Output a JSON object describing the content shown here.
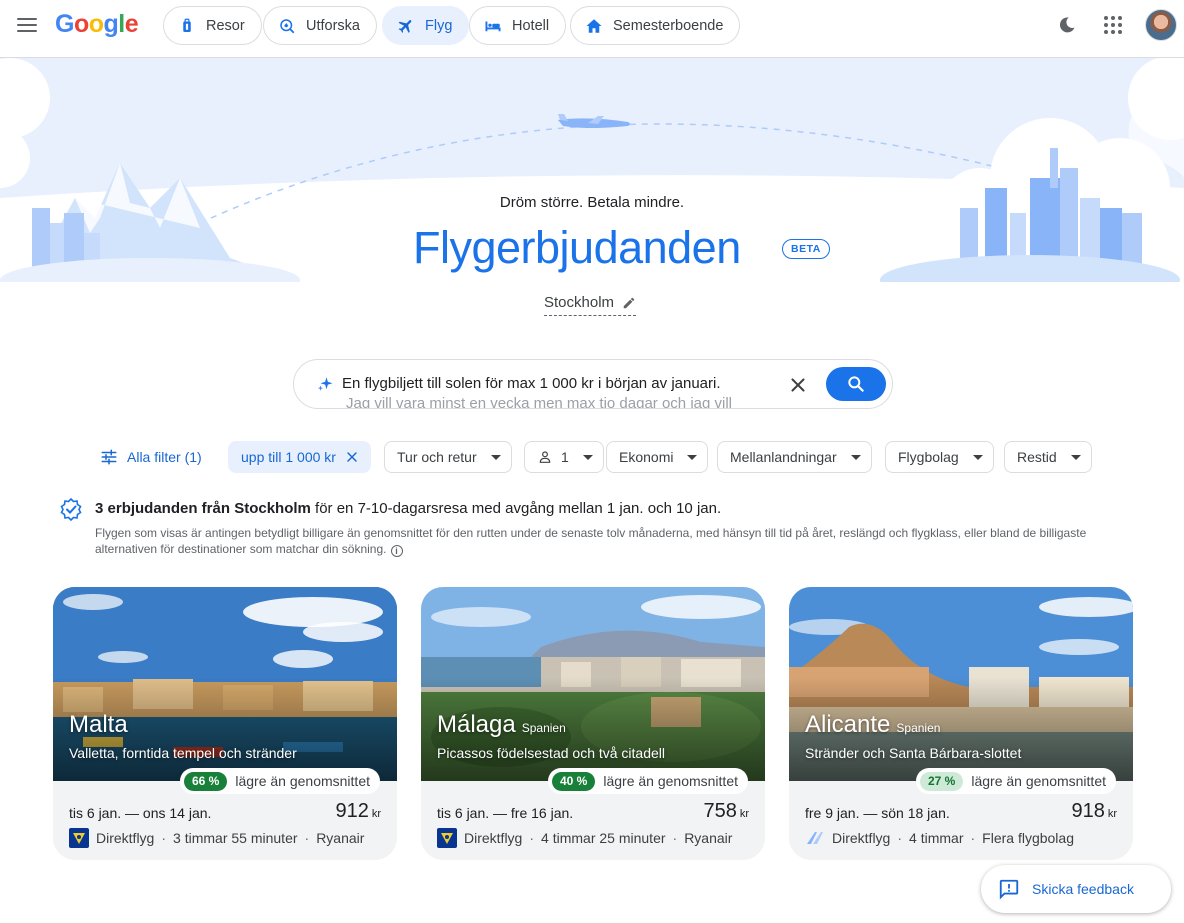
{
  "header": {
    "logo_letters": [
      "G",
      "o",
      "o",
      "g",
      "l",
      "e"
    ],
    "logo_colors": [
      "#4285F4",
      "#EA4335",
      "#FBBC05",
      "#4285F4",
      "#34A853",
      "#EA4335"
    ],
    "nav": [
      {
        "label": "Resor",
        "icon": "suitcase-icon",
        "active": false
      },
      {
        "label": "Utforska",
        "icon": "explore-icon",
        "active": false
      },
      {
        "label": "Flyg",
        "icon": "airplane-icon",
        "active": true
      },
      {
        "label": "Hotell",
        "icon": "bed-icon",
        "active": false
      },
      {
        "label": "Semesterboende",
        "icon": "house-icon",
        "active": false
      }
    ]
  },
  "hero": {
    "subtitle": "Dröm större. Betala mindre.",
    "title": "Flygerbjudanden",
    "badge": "BETA",
    "origin": "Stockholm"
  },
  "search": {
    "query_line1": "En flygbiljett till solen för max 1 000 kr i början av januari.",
    "query_line2": "Jag vill vara minst en vecka men max tio dagar och jag vill"
  },
  "filters": {
    "all_filters": "Alla filter (1)",
    "price_chip": "upp till 1 000 kr",
    "trip_type": "Tur och retur",
    "passengers": "1",
    "cabin": "Ekonomi",
    "stops": "Mellanlandningar",
    "airlines": "Flygbolag",
    "duration": "Restid"
  },
  "summary": {
    "bold": "3 erbjudanden från Stockholm",
    "rest": " för en 7-10-dagarsresa med avgång mellan 1 jan. och 10 jan.",
    "disclaimer": "Flygen som visas är antingen betydligt billigare än genomsnittet för den rutten under de senaste tolv månaderna, med hänsyn till tid på året, reslängd och flygklass, eller bland de billigaste alternativen för destinationer som matchar din sökning."
  },
  "deals": [
    {
      "city": "Malta",
      "country": "",
      "tagline": "Valletta, forntida tempel och stränder",
      "discount_pct": "66 %",
      "discount_label": "lägre än genomsnittet",
      "dates": "tis 6 jan. — ons 14 jan.",
      "price": "912",
      "currency": "kr",
      "stops": "Direktflyg",
      "duration": "3 timmar 55 minuter",
      "airline": "Ryanair"
    },
    {
      "city": "Málaga",
      "country": "Spanien",
      "tagline": "Picassos födelsestad och två citadell",
      "discount_pct": "40 %",
      "discount_label": "lägre än genomsnittet",
      "dates": "tis 6 jan. — fre 16 jan.",
      "price": "758",
      "currency": "kr",
      "stops": "Direktflyg",
      "duration": "4 timmar 25 minuter",
      "airline": "Ryanair"
    },
    {
      "city": "Alicante",
      "country": "Spanien",
      "tagline": "Stränder och Santa Bárbara-slottet",
      "discount_pct": "27 %",
      "discount_label": "lägre än genomsnittet",
      "dates": "fre 9 jan. — sön 18 jan.",
      "price": "918",
      "currency": "kr",
      "stops": "Direktflyg",
      "duration": "4 timmar",
      "airline": "Flera flygbolag"
    }
  ],
  "feedback": {
    "label": "Skicka feedback"
  },
  "colors": {
    "accent": "#1a73e8",
    "accent_light": "#e8f0fe",
    "deal_green": "#188038",
    "deal_green_light": "#ceead6"
  }
}
